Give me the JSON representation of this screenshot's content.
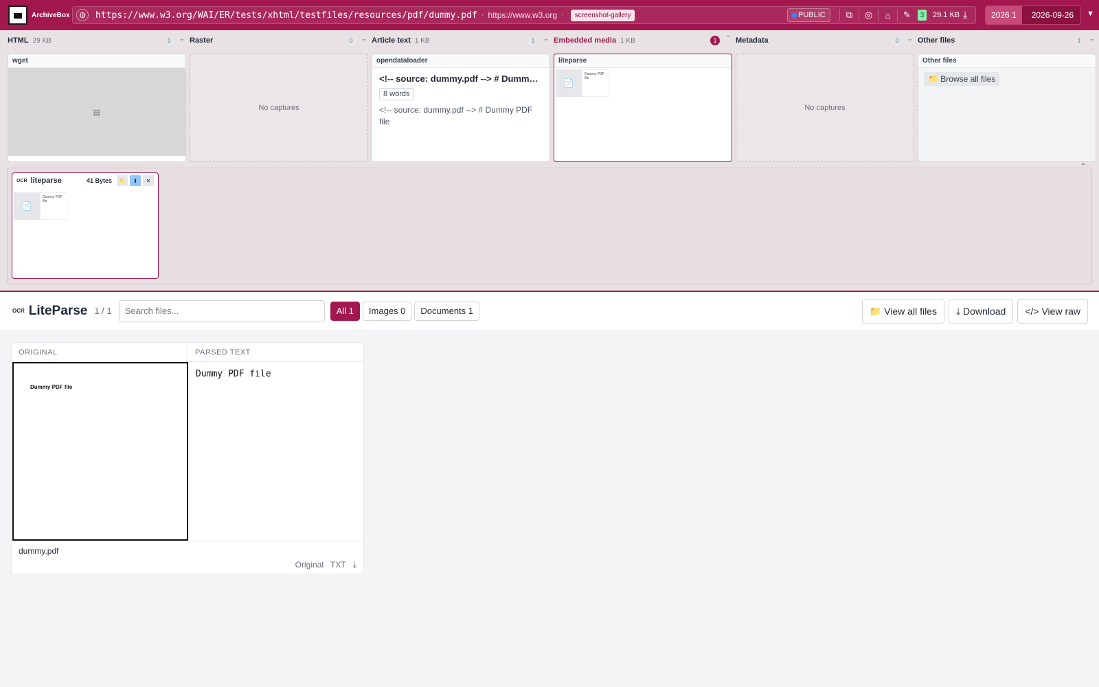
{
  "app": {
    "name": "ArchiveBox"
  },
  "topbar": {
    "url": "https://www.w3.org/WAI/ER/tests/xhtml/testfiles/resources/pdf/dummy.pdf",
    "domain": "https://www.w3.org",
    "tag": "screenshot-gallery",
    "visibility": "PUBLIC",
    "snapshot_count": "3",
    "total_size": "29.1 KB",
    "year_label": "2026 1",
    "date": "2026-09-26"
  },
  "columns": [
    {
      "name": "HTML",
      "size": "29 KB",
      "count": "1",
      "card_title": "wget"
    },
    {
      "name": "Raster",
      "size": "",
      "count": "0",
      "empty_text": "No captures"
    },
    {
      "name": "Article text",
      "size": "1 KB",
      "count": "1",
      "card_title": "opendataloader",
      "article_title": "<!-- source: dummy.pdf --> # Dummy PDF file",
      "word_count": "8 words",
      "article_body": "<!-- source: dummy.pdf --> # Dummy PDF file"
    },
    {
      "name": "Embedded media",
      "size": "1 KB",
      "count": "1",
      "card_title": "liteparse",
      "thumb_text": "Dummy PDF file"
    },
    {
      "name": "Metadata",
      "size": "",
      "count": "0",
      "empty_text": "No captures"
    },
    {
      "name": "Other files",
      "size": "",
      "count": "1",
      "card_title": "Other files",
      "browse_label": "Browse all files"
    }
  ],
  "detail": {
    "ocr_label": "OCR",
    "name": "liteparse",
    "size": "41 Bytes",
    "thumb_text": "Dummy PDF file"
  },
  "liteparse": {
    "ocr_label": "OCR",
    "title": "LiteParse",
    "count": "1 / 1",
    "search_placeholder": "Search files...",
    "filters": {
      "all": "All 1",
      "images": "Images 0",
      "documents": "Documents 1"
    },
    "actions": {
      "view_all": "📁 View all files",
      "download": "⤓ Download",
      "view_raw": "</> View raw"
    }
  },
  "viewer": {
    "original_label": "ORIGINAL",
    "parsed_label": "PARSED TEXT",
    "original_text": "Dummy PDF file",
    "parsed_text": "Dummy PDF file",
    "filename": "dummy.pdf",
    "links": {
      "original": "Original",
      "txt": "TXT",
      "download": "⤓"
    }
  },
  "colors": {
    "accent": "#a3174f",
    "active_count": "#a3174f"
  }
}
